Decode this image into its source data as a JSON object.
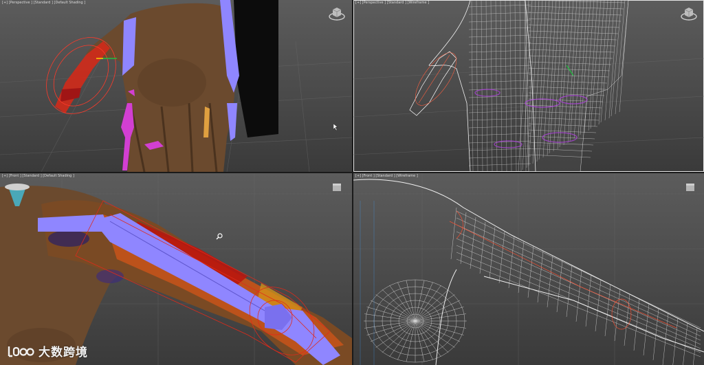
{
  "viewports": {
    "top_left": {
      "label": "[+] [Perspective ] [Standard ] [Default Shading ]"
    },
    "top_right": {
      "label": "[+] [Perspective ] [Standard ] [Wireframe ]"
    },
    "bottom_left": {
      "label": "[+] [Front ] [Standard ] [Default Shading ]"
    },
    "bottom_right": {
      "label": "[+] [Front ] [Standard ] [Wireframe ]"
    }
  },
  "watermark": {
    "logo": "ICO",
    "text": "大数跨境"
  },
  "colors": {
    "viewport_bg": "#4e4e4e",
    "skin": "#6b4a2e",
    "bone_purple": "#8f86ff",
    "envelope_red": "#d22a1a",
    "wire_white": "#f0f0f0",
    "active_border": "#e6e6e6"
  }
}
